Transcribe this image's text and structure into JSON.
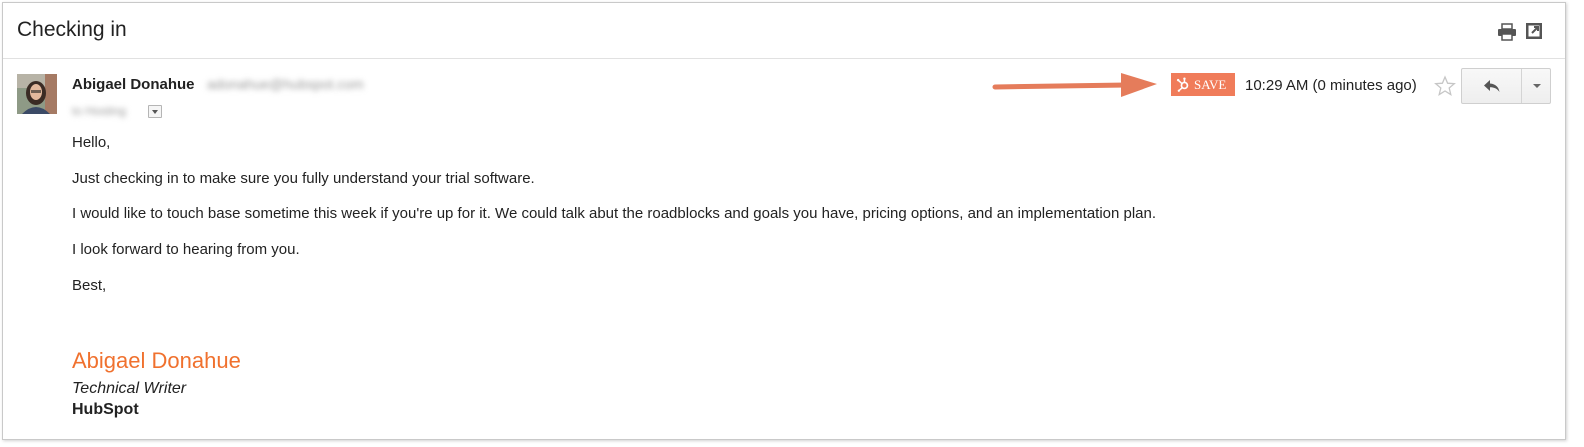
{
  "subject": "Checking in",
  "header_icons": {
    "print": "print-icon",
    "open_new_window": "open-in-new-window-icon"
  },
  "sender": {
    "name": "Abigael Donahue",
    "email": "adonahue@hubspot.com",
    "recipient": "to Hosting"
  },
  "save_button": {
    "label": "SAVE",
    "icon": "hubspot-sprocket-icon",
    "color": "#f07c5a"
  },
  "timestamp": "10:29 AM (0 minutes ago)",
  "actions": {
    "star": "star-icon",
    "reply": "reply-icon",
    "more": "chevron-down-icon"
  },
  "body": {
    "greeting": "Hello,",
    "paragraphs": [
      "Just checking in to make sure you fully understand your trial software.",
      "I would like to touch base sometime this week if you're up for it. We could talk abut the roadblocks and goals you have, pricing options, and an implementation plan.",
      "I look forward to hearing from you."
    ],
    "closing": "Best,"
  },
  "signature": {
    "name": "Abigael Donahue",
    "title": "Technical Writer",
    "company": "HubSpot",
    "name_color": "#f0712e"
  },
  "annotation_arrow_color": "#e57c5b"
}
